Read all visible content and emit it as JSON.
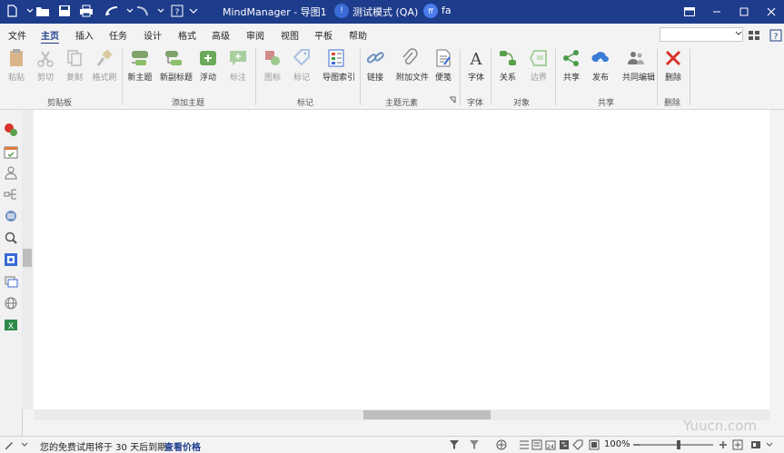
{
  "title_bar": {
    "app_title": "MindManager - 导图1",
    "mode_badge": "!",
    "mode_text": "测试模式 (QA)",
    "user_initials": "ff",
    "user_name": "fa"
  },
  "menu": {
    "items": [
      "文件",
      "主页",
      "插入",
      "任务",
      "设计",
      "格式",
      "高级",
      "审阅",
      "视图",
      "平板",
      "帮助"
    ],
    "active": "主页"
  },
  "ribbon": {
    "groups": [
      {
        "label": "剪贴板",
        "items": [
          "粘贴",
          "剪切",
          "复制",
          "格式刷"
        ]
      },
      {
        "label": "添加主题",
        "items": [
          "新主题",
          "新副标题",
          "浮动",
          "标注"
        ]
      },
      {
        "label": "标记",
        "items": [
          "图标",
          "标记",
          "导图索引"
        ]
      },
      {
        "label": "主题元素",
        "items": [
          "链接",
          "附加文件",
          "便笺"
        ]
      },
      {
        "label": "字体",
        "items": [
          "字体"
        ]
      },
      {
        "label": "对象",
        "items": [
          "关系",
          "边界"
        ]
      },
      {
        "label": "共享",
        "items": [
          "共享",
          "发布",
          "共同编辑"
        ]
      },
      {
        "label": "删除",
        "items": [
          "删除"
        ]
      }
    ]
  },
  "status_bar": {
    "trial_text": "您的免费试用将于 30 天后到期",
    "price_link": "查看价格",
    "zoom": "100%"
  },
  "watermark": "Yuucn.com",
  "colors": {
    "title_bar": "#1e3c8c",
    "accent": "#1e3c8c",
    "canvas": "#ffffff"
  }
}
